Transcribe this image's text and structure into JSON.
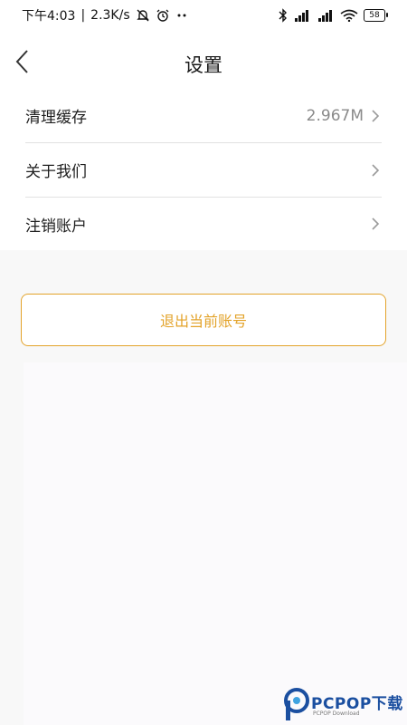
{
  "status_bar": {
    "time": "下午4:03",
    "speed": "2.3K/s",
    "battery": "58"
  },
  "header": {
    "title": "设置"
  },
  "settings": {
    "items": [
      {
        "label": "清理缓存",
        "value": "2.967M"
      },
      {
        "label": "关于我们",
        "value": ""
      },
      {
        "label": "注销账户",
        "value": ""
      }
    ]
  },
  "logout": {
    "label": "退出当前账号"
  },
  "watermark": {
    "brand": "PCPOP下载",
    "sub": "PCPOP Download"
  },
  "colors": {
    "accent": "#e3a32a",
    "background": "#f8f8f8",
    "watermark": "#1b4fa0"
  }
}
